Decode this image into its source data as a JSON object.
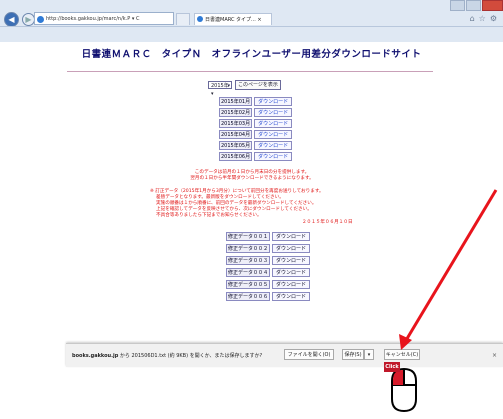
{
  "browser": {
    "address": "http://books.gakkou.jp/marc/n/k.P ▾ C",
    "tabs": [
      "",
      "日書連MARC タイプ... ×"
    ],
    "back_icon": "back-arrow-icon",
    "forward_icon": "forward-arrow-icon"
  },
  "page": {
    "title": "日書連ＭＡＲＣ　タイプＮ　オフラインユーザー用差分ダウンロードサイト",
    "year_select": "2015年 ▾",
    "show_button": "このページを表示",
    "monthly": [
      {
        "label": "2015年01月",
        "button": "ダウンロード"
      },
      {
        "label": "2015年02月",
        "button": "ダウンロード"
      },
      {
        "label": "2015年03月",
        "button": "ダウンロード"
      },
      {
        "label": "2015年04月",
        "button": "ダウンロード"
      },
      {
        "label": "2015年05月",
        "button": "ダウンロード"
      },
      {
        "label": "2015年06月",
        "button": "ダウンロード"
      }
    ],
    "notice1": "このデータは前月の１日から月末日の分を提供します。\n翌月の１日から半年間ダウンロードできるようになります。",
    "notice2": "※ 訂正データ（2015年1月から3月分）について前回分を再度お送りしております。\n　 差替データとなります。最新版をダウンロードしてください。\n　 実施の順番は１から順番に、前回のデータを最新ダウンロードしてください。\n　 上記を確認してデータを反映させてから、次にダウンロードしてください。\n　 不具合等ありましたら下記までお知らせください。",
    "date": "２０１５年０６月１０日",
    "corrections": [
      {
        "label": "修正データ００１",
        "button": "ダウンロード"
      },
      {
        "label": "修正データ００２",
        "button": "ダウンロード"
      },
      {
        "label": "修正データ００３",
        "button": "ダウンロード"
      },
      {
        "label": "修正データ００４",
        "button": "ダウンロード"
      },
      {
        "label": "修正データ００５",
        "button": "ダウンロード"
      },
      {
        "label": "修正データ００６",
        "button": "ダウンロード"
      }
    ]
  },
  "download_bar": {
    "site": "books.gakkou.jp",
    "message": " から 201506D1.txt (約 9KB) を開くか、または保存しますか?",
    "open": "ファイルを開く(O)",
    "save": "保存(S)",
    "dropdown": "▾",
    "cancel": "キャンセル(C)",
    "close": "×"
  },
  "overlay": {
    "click_label": "Click",
    "arrow_color": "#e8141c"
  }
}
